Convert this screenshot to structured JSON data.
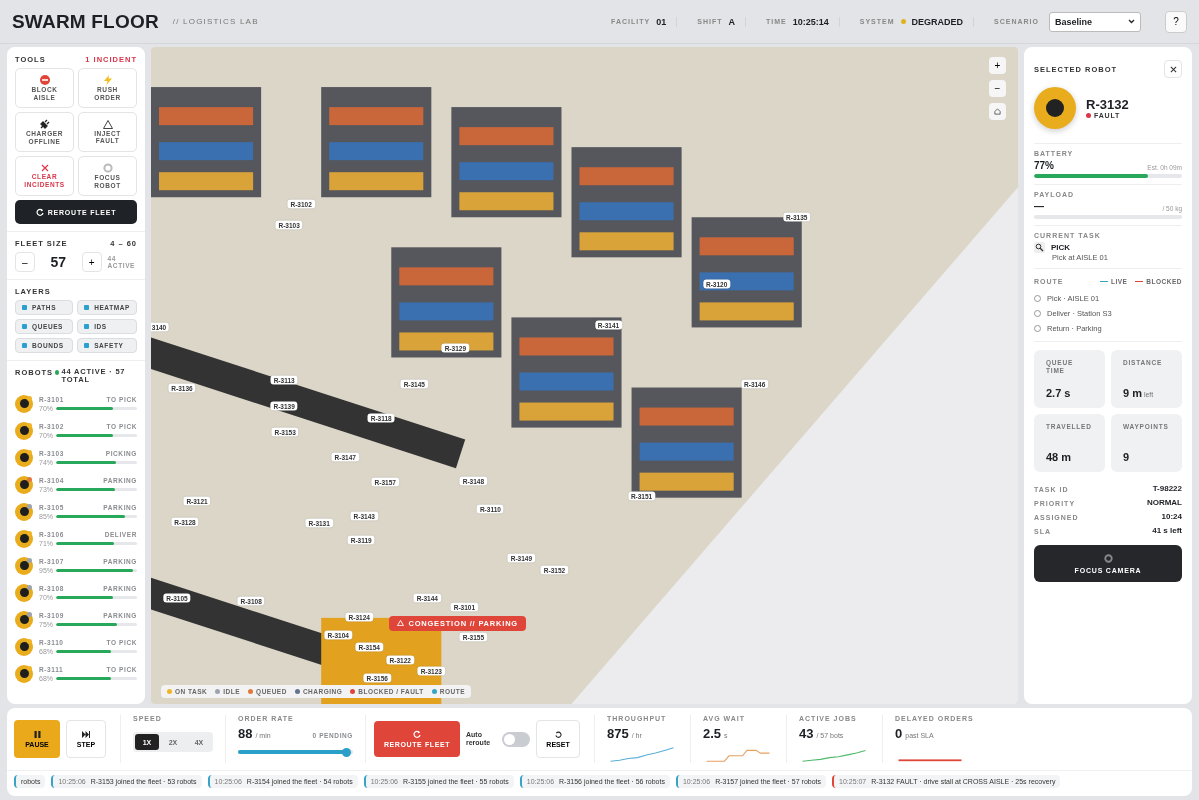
{
  "header": {
    "title": "SWARM FLOOR",
    "subtitle": "// LOGISTICS LAB",
    "stats": [
      {
        "label": "FACILITY",
        "value": "01"
      },
      {
        "label": "SHIFT",
        "value": "A"
      },
      {
        "label": "TIME",
        "value": "10:25:14"
      },
      {
        "label": "SYSTEM",
        "value": "DEGRADED",
        "color": "#e0b21c"
      }
    ],
    "scenario": {
      "label": "SCENARIO",
      "value": "Baseline"
    },
    "help": "?"
  },
  "tools": {
    "title": "TOOLS",
    "incidents": "1 INCIDENT",
    "items": [
      {
        "kind": "block",
        "label": "BLOCK AISLE",
        "danger": false
      },
      {
        "kind": "rush",
        "label": "RUSH ORDER",
        "danger": false
      },
      {
        "kind": "charger",
        "label": "CHARGER OFFLINE",
        "danger": false
      },
      {
        "kind": "fault",
        "label": "INJECT FAULT",
        "danger": false
      },
      {
        "kind": "clear",
        "label": "CLEAR INCIDENTS",
        "danger": true
      },
      {
        "kind": "focus",
        "label": "FOCUS ROBOT",
        "danger": false
      }
    ],
    "reroute": "REROUTE FLEET"
  },
  "fleet": {
    "title": "FLEET SIZE",
    "range": "4 – 60",
    "minus": "–",
    "value": "57",
    "plus": "+",
    "active": "44 ACTIVE"
  },
  "layers": {
    "title": "LAYERS",
    "items": [
      {
        "label": "PATHS",
        "on": true
      },
      {
        "label": "HEATMAP",
        "on": true
      },
      {
        "label": "QUEUES",
        "on": true
      },
      {
        "label": "IDS",
        "on": true
      },
      {
        "label": "BOUNDS",
        "on": true
      },
      {
        "label": "SAFETY",
        "on": true
      }
    ]
  },
  "robots": {
    "title": "ROBOTS",
    "summary": "44 ACTIVE · 57 TOTAL",
    "items": [
      {
        "id": "R-3101",
        "status": "TO PICK",
        "battery": "70%",
        "level": 0.7,
        "color": "#f0b429"
      },
      {
        "id": "R-3102",
        "status": "TO PICK",
        "battery": "70%",
        "level": 0.7,
        "color": "#f0b429"
      },
      {
        "id": "R-3103",
        "status": "PICKING",
        "battery": "74%",
        "level": 0.74,
        "color": "#f0b429"
      },
      {
        "id": "R-3104",
        "status": "PARKING",
        "battery": "73%",
        "level": 0.73,
        "color": "#e07a3c"
      },
      {
        "id": "R-3105",
        "status": "PARKING",
        "battery": "85%",
        "level": 0.85,
        "color": "#9ca3af"
      },
      {
        "id": "R-3106",
        "status": "DELIVER",
        "battery": "71%",
        "level": 0.71,
        "color": "#f0b429"
      },
      {
        "id": "R-3107",
        "status": "PARKING",
        "battery": "95%",
        "level": 0.95,
        "color": "#9ca3af"
      },
      {
        "id": "R-3108",
        "status": "PARKING",
        "battery": "70%",
        "level": 0.7,
        "color": "#9ca3af"
      },
      {
        "id": "R-3109",
        "status": "PARKING",
        "battery": "75%",
        "level": 0.75,
        "color": "#9ca3af"
      },
      {
        "id": "R-3110",
        "status": "TO PICK",
        "battery": "68%",
        "level": 0.68,
        "color": "#f0b429"
      },
      {
        "id": "R-3111",
        "status": "TO PICK",
        "battery": "68%",
        "level": 0.68,
        "color": "#f0b429"
      }
    ]
  },
  "scene": {
    "labels": [
      "R-3102",
      "R-3103",
      "R-3135",
      "R-3120",
      "3140",
      "R-3141",
      "R-3129",
      "R-3136",
      "R-3113",
      "R-3145",
      "R-3139",
      "R-3146",
      "R-3118",
      "R-3153",
      "R-3147",
      "R-3157",
      "R-3148",
      "R-3151",
      "R-3121",
      "R-3110",
      "R-3128",
      "R-3131",
      "R-3143",
      "R-3119",
      "R-3149",
      "R-3152",
      "R-3105",
      "R-3108",
      "R-3144",
      "R-3101",
      "R-3124",
      "R-3104",
      "R-3155",
      "R-3154",
      "R-3122",
      "R-3123",
      "R-3156"
    ],
    "alert": "CONGESTION // PARKING",
    "zoom": [
      "+",
      "−"
    ],
    "legend": [
      {
        "label": "ON TASK",
        "color": "#f0b429"
      },
      {
        "label": "IDLE",
        "color": "#9ca3af"
      },
      {
        "label": "QUEUED",
        "color": "#e07a3c"
      },
      {
        "label": "CHARGING",
        "color": "#64748b"
      },
      {
        "label": "BLOCKED / FAULT",
        "color": "#e0453a"
      },
      {
        "label": "ROUTE",
        "color": "#38a3c8"
      }
    ]
  },
  "selected": {
    "title": "SELECTED ROBOT",
    "id": "R-3132",
    "status": "FAULT",
    "battery": {
      "label": "BATTERY",
      "value": "77%",
      "estimate": "Est. 0h 09m",
      "level": 0.77
    },
    "payload": {
      "label": "PAYLOAD",
      "value": "—",
      "capacity": "/ 50 kg"
    },
    "task": {
      "label": "CURRENT TASK",
      "name": "PICK",
      "detail": "Pick at AISLE 01"
    },
    "route": {
      "label": "ROUTE",
      "legend": [
        {
          "label": "LIVE",
          "color": "#38a3c8"
        },
        {
          "label": "BLOCKED",
          "color": "#e0453a"
        }
      ],
      "steps": [
        "Pick · AISLE 01",
        "Deliver · Station S3",
        "Return · Parking"
      ]
    },
    "tiles": [
      {
        "label": "QUEUE TIME",
        "value": "2.7 s"
      },
      {
        "label": "DISTANCE",
        "value": "9 m",
        "unit": "left"
      },
      {
        "label": "TRAVELLED",
        "value": "48 m"
      },
      {
        "label": "WAYPOINTS",
        "value": "9"
      }
    ],
    "facts": [
      {
        "label": "TASK ID",
        "value": "T-98222"
      },
      {
        "label": "PRIORITY",
        "value": "NORMAL"
      },
      {
        "label": "ASSIGNED",
        "value": "10:24"
      },
      {
        "label": "SLA",
        "value": "41 s left"
      }
    ],
    "focus": "FOCUS CAMERA"
  },
  "controls": {
    "pause": "PAUSE",
    "step": "STEP",
    "speed": {
      "label": "SPEED",
      "options": [
        {
          "label": "1X",
          "selected": true
        },
        {
          "label": "2X",
          "selected": false
        },
        {
          "label": "4X",
          "selected": false
        }
      ]
    },
    "order_rate": {
      "label": "ORDER RATE",
      "value": "88",
      "unit": "/ min",
      "pending": "0 PENDING",
      "level": 0.95
    },
    "reroute": "REROUTE FLEET",
    "auto_reroute": {
      "label": "Auto reroute",
      "on": false
    },
    "reset": "RESET",
    "metrics": [
      {
        "label": "THROUGHPUT",
        "value": "875",
        "unit": "/ hr",
        "color": "#5aaed6"
      },
      {
        "label": "AVG WAIT",
        "value": "2.5",
        "unit": "s",
        "color": "#e8a060"
      },
      {
        "label": "ACTIVE JOBS",
        "value": "43",
        "unit": "/ 57 bots",
        "color": "#4cba6a"
      },
      {
        "label": "DELAYED ORDERS",
        "value": "0",
        "unit": "past SLA",
        "color": "#e0453a"
      }
    ]
  },
  "ticker": [
    {
      "text": "robots",
      "color": "#38a3c8"
    },
    {
      "time": "10:25:06",
      "text": "R-3153 joined the fleet · 53 robots",
      "color": "#38a3c8"
    },
    {
      "time": "10:25:06",
      "text": "R-3154 joined the fleet · 54 robots",
      "color": "#38a3c8"
    },
    {
      "time": "10:25:06",
      "text": "R-3155 joined the fleet · 55 robots",
      "color": "#38a3c8"
    },
    {
      "time": "10:25:06",
      "text": "R-3156 joined the fleet · 56 robots",
      "color": "#38a3c8"
    },
    {
      "time": "10:25:06",
      "text": "R-3157 joined the fleet · 57 robots",
      "color": "#38a3c8"
    },
    {
      "time": "10:25:07",
      "text": "R-3132 FAULT · drive stall at CROSS AISLE · 25s recovery",
      "color": "#e0453a"
    }
  ]
}
